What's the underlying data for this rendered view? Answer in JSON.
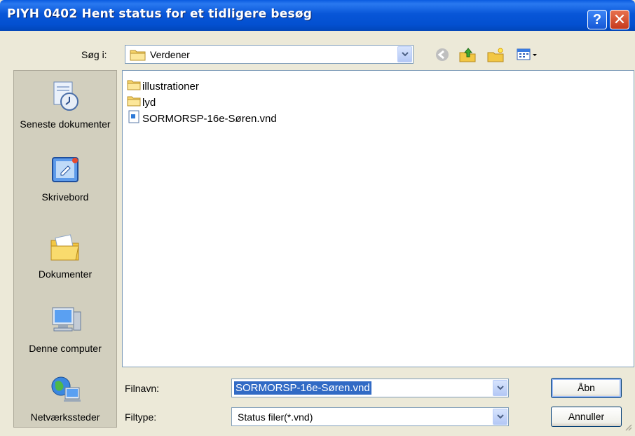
{
  "window": {
    "title": "PIYH 0402 Hent status for et tidligere besøg",
    "help_label": "?",
    "close_label": "✕"
  },
  "look_in": {
    "label": "Søg i:",
    "value": "Verdener"
  },
  "toolbar": {
    "icons": [
      "back-icon",
      "up-folder-icon",
      "new-folder-icon",
      "view-menu-icon"
    ]
  },
  "places": [
    {
      "label": "Seneste dokumenter",
      "icon": "recent-documents-icon"
    },
    {
      "label": "Skrivebord",
      "icon": "desktop-icon"
    },
    {
      "label": "Dokumenter",
      "icon": "my-documents-icon"
    },
    {
      "label": "Denne computer",
      "icon": "my-computer-icon"
    },
    {
      "label": "Netværkssteder",
      "icon": "network-places-icon"
    }
  ],
  "files": [
    {
      "name": "illustrationer",
      "type": "folder"
    },
    {
      "name": "lyd",
      "type": "folder"
    },
    {
      "name": "SORMORSP-16e-Søren.vnd",
      "type": "file"
    }
  ],
  "filename": {
    "label": "Filnavn:",
    "value": "SORMORSP-16e-Søren.vnd"
  },
  "filetype": {
    "label": "Filtype:",
    "value": "Status filer(*.vnd)"
  },
  "buttons": {
    "open": "Åbn",
    "cancel": "Annuller"
  },
  "colors": {
    "titlebar": "#0A5BE0",
    "dialog_bg": "#ECE9D8",
    "selection": "#316AC5"
  }
}
